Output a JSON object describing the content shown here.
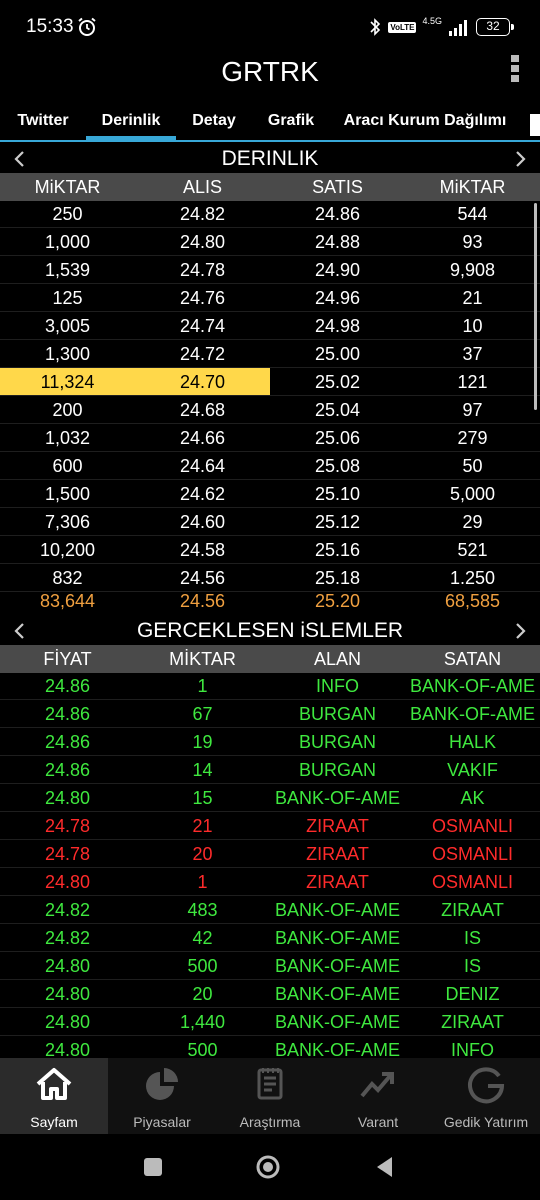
{
  "status_bar": {
    "time": "15:33",
    "network": "4.5G",
    "volte": "VoLTE",
    "battery": "32"
  },
  "app": {
    "title": "GRTRK"
  },
  "tabs": [
    {
      "label": "Twitter",
      "active": false
    },
    {
      "label": "Derinlik",
      "active": true
    },
    {
      "label": "Detay",
      "active": false
    },
    {
      "label": "Grafik",
      "active": false
    },
    {
      "label": "Aracı Kurum Dağılımı",
      "active": false
    }
  ],
  "depth": {
    "title": "DERINLIK",
    "headers": [
      "MiKTAR",
      "ALIS",
      "SATIS",
      "MiKTAR"
    ],
    "rows": [
      [
        "250",
        "24.82",
        "24.86",
        "544"
      ],
      [
        "1,000",
        "24.80",
        "24.88",
        "93"
      ],
      [
        "1,539",
        "24.78",
        "24.90",
        "9,908"
      ],
      [
        "125",
        "24.76",
        "24.96",
        "21"
      ],
      [
        "3,005",
        "24.74",
        "24.98",
        "10"
      ],
      [
        "1,300",
        "24.72",
        "25.00",
        "37"
      ],
      [
        "11,324",
        "24.70",
        "25.02",
        "121"
      ],
      [
        "200",
        "24.68",
        "25.04",
        "97"
      ],
      [
        "1,032",
        "24.66",
        "25.06",
        "279"
      ],
      [
        "600",
        "24.64",
        "25.08",
        "50"
      ],
      [
        "1,500",
        "24.62",
        "25.10",
        "5,000"
      ],
      [
        "7,306",
        "24.60",
        "25.12",
        "29"
      ],
      [
        "10,200",
        "24.58",
        "25.16",
        "521"
      ],
      [
        "832",
        "24.56",
        "25.18",
        "1.250"
      ]
    ],
    "highlight_row": 6,
    "totals": [
      "83,644",
      "24.56",
      "25.20",
      "68,585"
    ],
    "highlight_color": "#ffd84a",
    "total_color": "#f0a040"
  },
  "trades": {
    "title": "GERCEKLESEN iSLEMLER",
    "headers": [
      "FİYAT",
      "MİKTAR",
      "ALAN",
      "SATAN"
    ],
    "rows": [
      {
        "price": "24.86",
        "qty": "1",
        "buyer": "INFO",
        "seller": "BANK-OF-AME",
        "dir": "up"
      },
      {
        "price": "24.86",
        "qty": "67",
        "buyer": "BURGAN",
        "seller": "BANK-OF-AME",
        "dir": "up"
      },
      {
        "price": "24.86",
        "qty": "19",
        "buyer": "BURGAN",
        "seller": "HALK",
        "dir": "up"
      },
      {
        "price": "24.86",
        "qty": "14",
        "buyer": "BURGAN",
        "seller": "VAKIF",
        "dir": "up"
      },
      {
        "price": "24.80",
        "qty": "15",
        "buyer": "BANK-OF-AME",
        "seller": "AK",
        "dir": "up"
      },
      {
        "price": "24.78",
        "qty": "21",
        "buyer": "ZIRAAT",
        "seller": "OSMANLI",
        "dir": "down"
      },
      {
        "price": "24.78",
        "qty": "20",
        "buyer": "ZIRAAT",
        "seller": "OSMANLI",
        "dir": "down"
      },
      {
        "price": "24.80",
        "qty": "1",
        "buyer": "ZIRAAT",
        "seller": "OSMANLI",
        "dir": "down"
      },
      {
        "price": "24.82",
        "qty": "483",
        "buyer": "BANK-OF-AME",
        "seller": "ZIRAAT",
        "dir": "up"
      },
      {
        "price": "24.82",
        "qty": "42",
        "buyer": "BANK-OF-AME",
        "seller": "IS",
        "dir": "up"
      },
      {
        "price": "24.80",
        "qty": "500",
        "buyer": "BANK-OF-AME",
        "seller": "IS",
        "dir": "up"
      },
      {
        "price": "24.80",
        "qty": "20",
        "buyer": "BANK-OF-AME",
        "seller": "DENIZ",
        "dir": "up"
      },
      {
        "price": "24.80",
        "qty": "1,440",
        "buyer": "BANK-OF-AME",
        "seller": "ZIRAAT",
        "dir": "up"
      },
      {
        "price": "24.80",
        "qty": "500",
        "buyer": "BANK-OF-AME",
        "seller": "INFO",
        "dir": "up"
      }
    ],
    "up_color": "#3fe83f",
    "down_color": "#ff2b2b"
  },
  "bottom_nav": [
    {
      "label": "Sayfam",
      "icon": "home-icon",
      "active": true
    },
    {
      "label": "Piyasalar",
      "icon": "pie-chart-icon",
      "active": false
    },
    {
      "label": "Araştırma",
      "icon": "notepad-icon",
      "active": false
    },
    {
      "label": "Varant",
      "icon": "trend-arrow-icon",
      "active": false
    },
    {
      "label": "Gedik Yatırım",
      "icon": "gedik-logo-icon",
      "active": false
    }
  ],
  "colors": {
    "accent": "#38a8d8",
    "header_bg": "#4a4a4a"
  }
}
